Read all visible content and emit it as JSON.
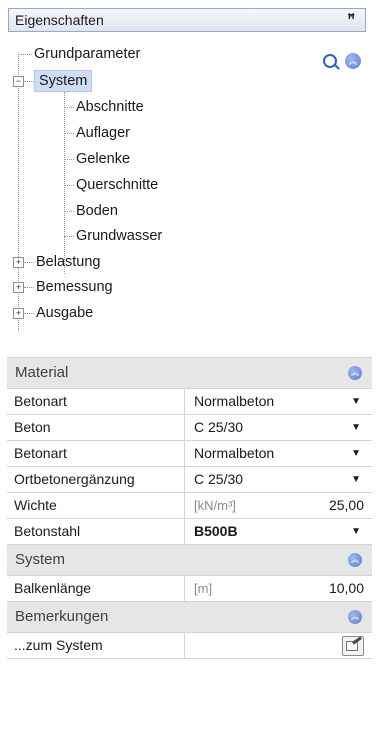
{
  "panel": {
    "title": "Eigenschaften",
    "pin_icon": "pin-icon"
  },
  "tree": {
    "items": [
      {
        "label": "Grundparameter"
      },
      {
        "label": "System",
        "selected": true
      },
      {
        "label": "Abschnitte"
      },
      {
        "label": "Auflager"
      },
      {
        "label": "Gelenke"
      },
      {
        "label": "Querschnitte"
      },
      {
        "label": "Boden"
      },
      {
        "label": "Grundwasser"
      },
      {
        "label": "Belastung"
      },
      {
        "label": "Bemessung"
      },
      {
        "label": "Ausgabe"
      }
    ]
  },
  "grid": {
    "sections": [
      {
        "label": "Material",
        "rows": [
          {
            "name": "Betonart",
            "value": "Normalbeton",
            "type": "dropdown"
          },
          {
            "name": "Beton",
            "value": "C 25/30",
            "type": "dropdown"
          },
          {
            "name": "Betonart",
            "value": "Normalbeton",
            "type": "dropdown"
          },
          {
            "name": "Ortbetonergänzung",
            "value": "C 25/30",
            "type": "dropdown"
          },
          {
            "name": "Wichte",
            "unit": "[kN/m³]",
            "value": "25,00",
            "type": "number"
          },
          {
            "name": "Betonstahl",
            "value": "B500B",
            "type": "dropdown",
            "bold": true
          }
        ]
      },
      {
        "label": "System",
        "rows": [
          {
            "name": "Balkenlänge",
            "unit": "[m]",
            "value": "10,00",
            "type": "number"
          }
        ]
      },
      {
        "label": "Bemerkungen",
        "rows": [
          {
            "name": "...zum System",
            "value": "",
            "type": "edit"
          }
        ]
      }
    ]
  },
  "colors": {
    "selection": "#cfdcf4",
    "section_bg": "#e6e6e6",
    "accent": "#5a7fd1"
  }
}
